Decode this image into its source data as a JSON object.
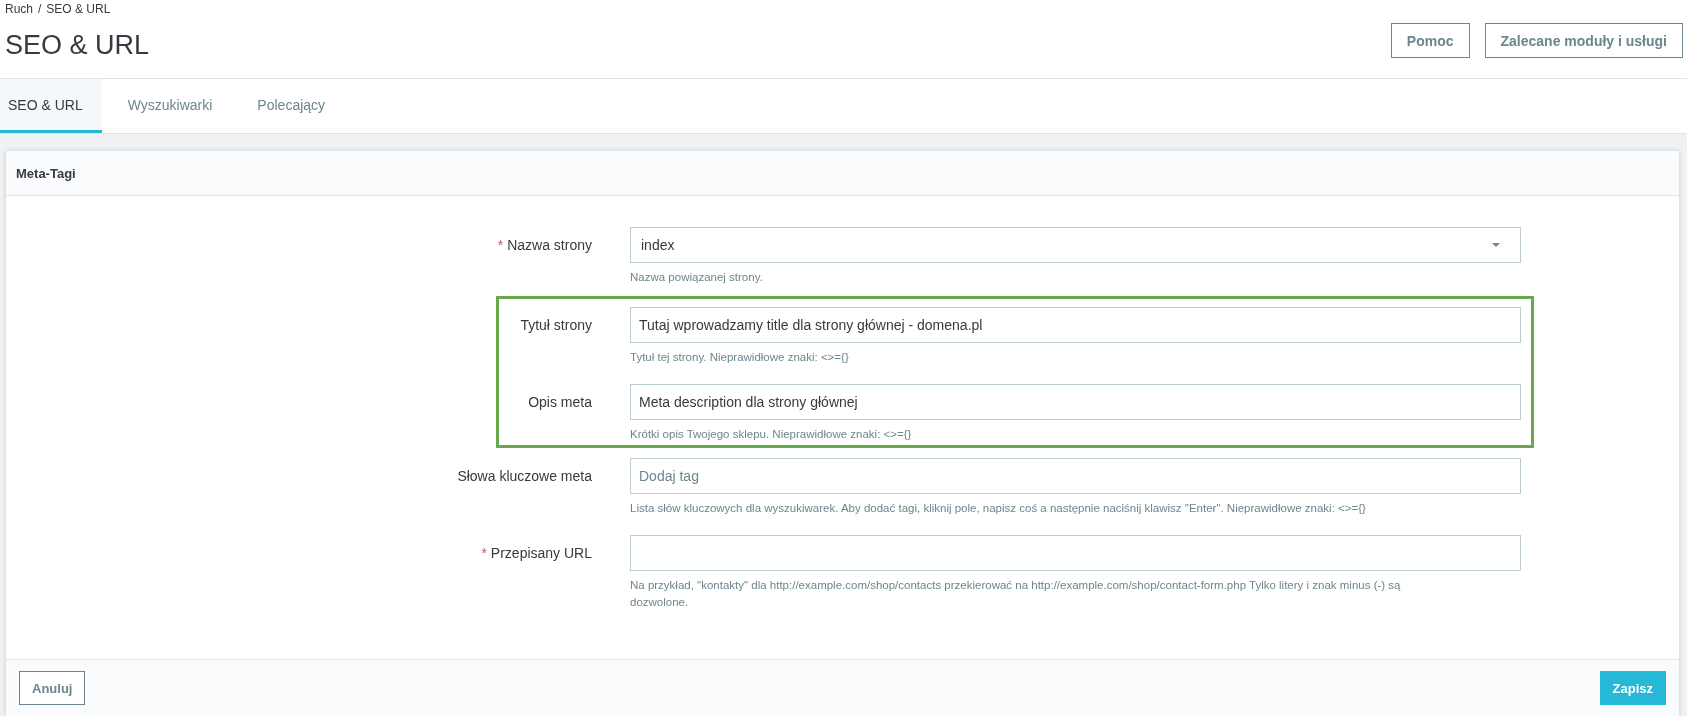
{
  "breadcrumb": {
    "items": [
      "Ruch",
      "SEO & URL"
    ],
    "separator": "/"
  },
  "page_title": "SEO & URL",
  "toolbar_buttons": [
    "Pomoc",
    "Zalecane moduły i usługi"
  ],
  "tabs": [
    {
      "label": "SEO & URL",
      "selected": true
    },
    {
      "label": "Wyszukiwarki",
      "selected": false
    },
    {
      "label": "Polecający",
      "selected": false
    }
  ],
  "panel": {
    "title": "Meta-Tagi",
    "rows": [
      {
        "kind": "select",
        "label": "Nazwa strony",
        "required_mark": "*",
        "value": "index",
        "hint": "Nazwa powiązanej strony.",
        "highlighted": false
      },
      {
        "kind": "text",
        "label": "Tytuł strony",
        "value": "Tutaj wprowadzamy title dla strony głównej - domena.pl",
        "hint": "Tytuł tej strony. Nieprawidłowe znaki: <>={}",
        "highlighted": true
      },
      {
        "kind": "text",
        "label": "Opis meta",
        "value": "Meta description dla strony głównej",
        "hint": "Krótki opis Twojego sklepu. Nieprawidłowe znaki: <>={}",
        "highlighted": true
      },
      {
        "kind": "tags",
        "label": "Słowa kluczowe meta",
        "placeholder": "Dodaj tag",
        "hint": "Lista słów kluczowych dla wyszukiwarek. Aby dodać tagi, kliknij pole, napisz coś a następnie naciśnij klawisz \"Enter\". Nieprawidłowe znaki: <>={}",
        "highlighted": false
      },
      {
        "kind": "text",
        "label": "Przepisany URL",
        "required_mark": "*",
        "hint": "Na przykład, \"kontakty\" dla http://example.com/shop/contacts przekierować na http://example.com/shop/contact-form.php Tylko litery i znak minus (-) są dozwolone.",
        "highlighted": false
      }
    ],
    "buttons": [
      {
        "label": "Anuluj",
        "kind": "secondary"
      },
      {
        "label": "Zapisz",
        "kind": "primary"
      }
    ]
  }
}
